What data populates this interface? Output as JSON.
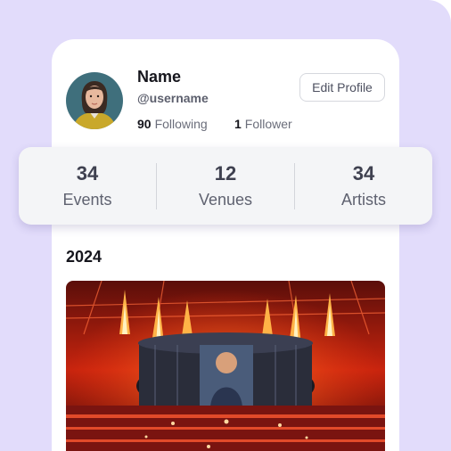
{
  "profile": {
    "name": "Name",
    "username": "@username",
    "following_count": "90",
    "following_label": "Following",
    "followers_count": "1",
    "followers_label": "Follower",
    "edit_button": "Edit Profile",
    "avatar_icon": "user-avatar-photo"
  },
  "stats": [
    {
      "value": "34",
      "label": "Events"
    },
    {
      "value": "12",
      "label": "Venues"
    },
    {
      "value": "34",
      "label": "Artists"
    }
  ],
  "timeline": {
    "year": "2024",
    "event_image_icon": "concert-stage-photo"
  },
  "colors": {
    "background": "#e2dcfb",
    "card": "#ffffff",
    "stats_card": "#f4f5f7",
    "text_primary": "#16161d",
    "text_secondary": "#5c5f6d"
  }
}
